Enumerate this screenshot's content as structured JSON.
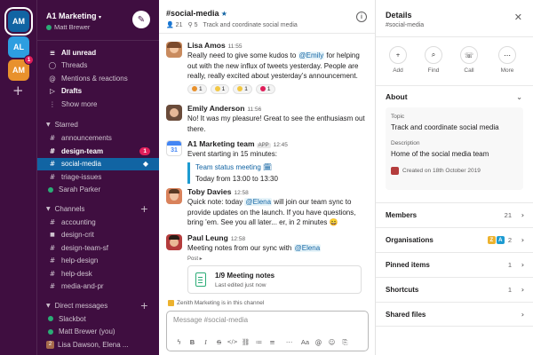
{
  "rail": {
    "workspaces": [
      {
        "initials": "AM",
        "color": "#1164a3"
      },
      {
        "initials": "AL",
        "color": "#2d9ee0"
      },
      {
        "initials": "AM",
        "color": "#e8912d",
        "badge": "1"
      }
    ],
    "add": "+"
  },
  "sidebar": {
    "workspace_name": "A1 Marketing",
    "user": "Matt Brewer",
    "nav": [
      {
        "icon": "≡",
        "label": "All unread",
        "bold": true
      },
      {
        "icon": "◯",
        "label": "Threads",
        "bold": false
      },
      {
        "icon": "@",
        "label": "Mentions & reactions",
        "bold": false
      },
      {
        "icon": "▷",
        "label": "Drafts",
        "bold": true
      },
      {
        "icon": "⋮",
        "label": "Show more",
        "bold": false
      }
    ],
    "starred_title": "Starred",
    "starred": [
      {
        "label": "announcements",
        "bold": false
      },
      {
        "label": "design-team",
        "bold": true,
        "count": "1"
      },
      {
        "label": "social-media",
        "selected": true
      },
      {
        "label": "triage-issues",
        "bold": false
      },
      {
        "label": "Sarah Parker",
        "person": true
      }
    ],
    "channels_title": "Channels",
    "channels": [
      {
        "label": "accounting",
        "icon": "#"
      },
      {
        "label": "design-crit",
        "icon": "🔒"
      },
      {
        "label": "design-team-sf",
        "icon": "#"
      },
      {
        "label": "help-design",
        "icon": "#"
      },
      {
        "label": "help-desk",
        "icon": "#"
      },
      {
        "label": "media-and-pr",
        "icon": "#"
      }
    ],
    "dm_title": "Direct messages",
    "dms": [
      {
        "label": "Slackbot",
        "presence": "on"
      },
      {
        "label": "Matt Brewer (you)",
        "presence": "on"
      },
      {
        "label": "Lisa Dawson, Elena ...",
        "presence": "group",
        "initials": "2"
      }
    ]
  },
  "channel": {
    "name": "#social-media",
    "members": "21",
    "pins": "5",
    "topic": "Track and coordinate social media",
    "messages": [
      {
        "name": "Lisa Amos",
        "time": "11:55",
        "pre": "Really need to give some kudos to ",
        "mention": "@Emily",
        "post": " for helping out with the new influx of tweets yesterday. People are really, really excited about yesterday’s announcement.",
        "reactions": [
          {
            "count": "1",
            "color": "#e8912d"
          },
          {
            "count": "1",
            "color": "#f2c744"
          },
          {
            "count": "1",
            "color": "#f2c744"
          },
          {
            "count": "1",
            "color": "#e01e5a"
          }
        ]
      },
      {
        "name": "Emily Anderson",
        "time": "11:56",
        "text": "No! It was my pleasure! Great to see the enthusiasm out there."
      },
      {
        "name": "A1 Marketing team",
        "app_tag": "APP",
        "time": "12:45",
        "text": "Event starting in 15 minutes:",
        "link": "Team status meeting 🗓",
        "detail": "Today from 13:00 to 13:30"
      },
      {
        "name": "Toby Davies",
        "time": "12:58",
        "pre": "Quick note: today ",
        "mention": "@Elena",
        "post": " will join our team sync to provide updates on the launch. If you have questions, bring ’em. See you all later... er, in 2 minutes 😄"
      },
      {
        "name": "Paul Leung",
        "time": "12:58",
        "pre": "Meeting notes from our sync with ",
        "mention": "@Elena",
        "post": "",
        "post_label": "Post ▸",
        "post_title": "1/9 Meeting notes",
        "post_sub": "Last edited just now"
      }
    ],
    "zenith_note": "Zenith Marketing is in this channel",
    "composer_placeholder": "Message #social-media",
    "toolbar": [
      "ϟ",
      "B",
      "I",
      "S",
      "</>",
      "⛓",
      "≔",
      "≡",
      "⋯",
      "Aa",
      "@",
      "☺",
      "⎘"
    ]
  },
  "details": {
    "title": "Details",
    "subtitle": "#social-media",
    "actions": [
      {
        "icon": "👤+",
        "label": "Add"
      },
      {
        "icon": "⌕",
        "label": "Find"
      },
      {
        "icon": "☏",
        "label": "Call"
      },
      {
        "icon": "⋯",
        "label": "More"
      }
    ],
    "about_title": "About",
    "topic_label": "Topic",
    "topic_value": "Track and coordinate social media",
    "description_label": "Description",
    "description_value": "Home of the social media team",
    "created": "Created on 18th October 2019",
    "rows": [
      {
        "label": "Members",
        "count": "21"
      },
      {
        "label": "Organisations",
        "count": "2"
      },
      {
        "label": "Pinned items",
        "count": "1"
      },
      {
        "label": "Shortcuts",
        "count": "1"
      },
      {
        "label": "Shared files",
        "count": ""
      }
    ]
  }
}
